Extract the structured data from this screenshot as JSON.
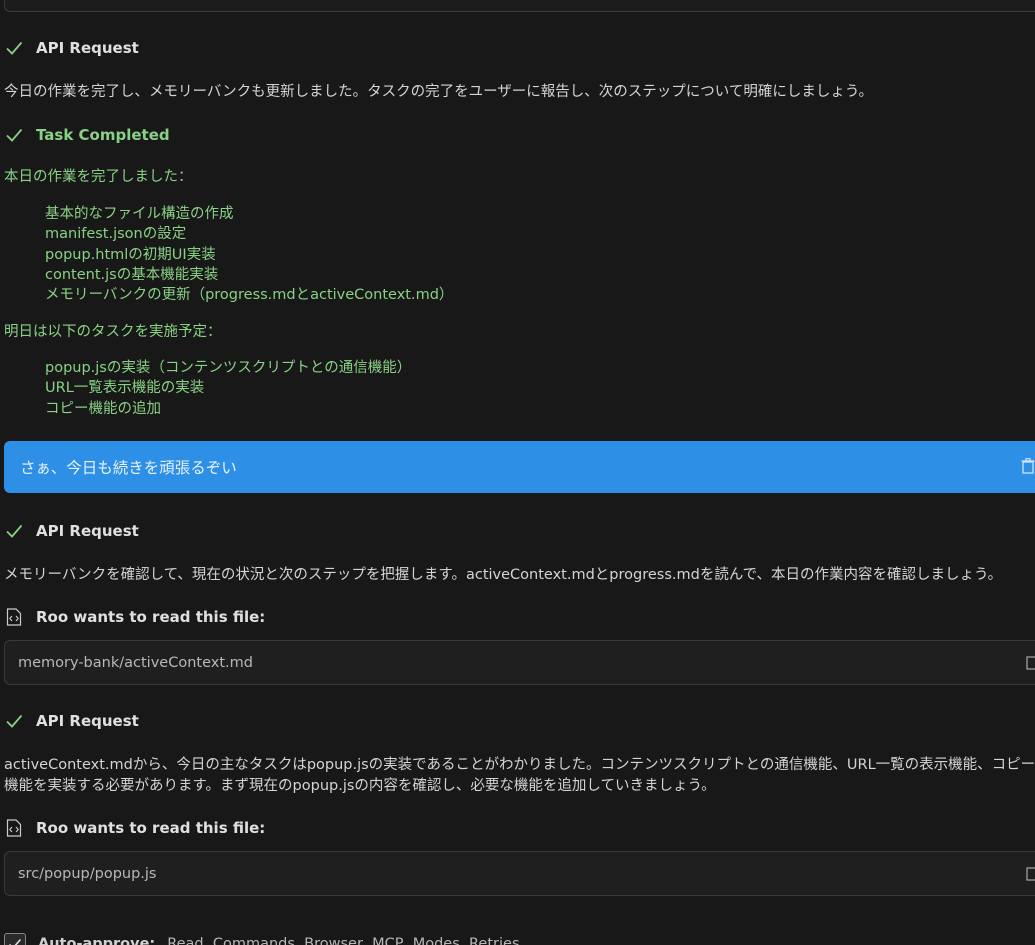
{
  "messages": {
    "api1": {
      "label": "API Request"
    },
    "api1_text": "今日の作業を完了し、メモリーバンクも更新しました。タスクの完了をユーザーに報告し、次のステップについて明確にしましょう。",
    "task": {
      "label": "Task Completed"
    },
    "task_intro": "本日の作業を完了しました：",
    "task_done_items": [
      "基本的なファイル構造の作成",
      "manifest.jsonの設定",
      "popup.htmlの初期UI実装",
      "content.jsの基本機能実装",
      "メモリーバンクの更新（progress.mdとactiveContext.md）"
    ],
    "task_next_intro": "明日は以下のタスクを実施予定：",
    "task_next_items": [
      "popup.jsの実装（コンテンツスクリプトとの通信機能）",
      "URL一覧表示機能の実装",
      "コピー機能の追加"
    ],
    "user_message": "さぁ、今日も続きを頑張るぞい",
    "api2": {
      "label": "API Request"
    },
    "api2_text": "メモリーバンクを確認して、現在の状況と次のステップを把握します。activeContext.mdとprogress.mdを読んで、本日の作業内容を確認しましょう。",
    "read1": {
      "label": "Roo wants to read this file:",
      "path": "memory-bank/activeContext.md"
    },
    "api3": {
      "label": "API Request"
    },
    "api3_text": "activeContext.mdから、今日の主なタスクはpopup.jsの実装であることがわかりました。コンテンツスクリプトとの通信機能、URL一覧の表示機能、コピー機能を実装する必要があります。まず現在のpopup.jsの内容を確認し、必要な機能を追加していきましょう。",
    "read2": {
      "label": "Roo wants to read this file:",
      "path": "src/popup/popup.js"
    }
  },
  "auto_approve": {
    "label": "Auto-approve:",
    "items": "Read, Commands, Browser, MCP, Modes, Retries"
  },
  "colors": {
    "background": "#181818",
    "success_green": "#89d185",
    "user_bubble": "#2d8fe6"
  }
}
